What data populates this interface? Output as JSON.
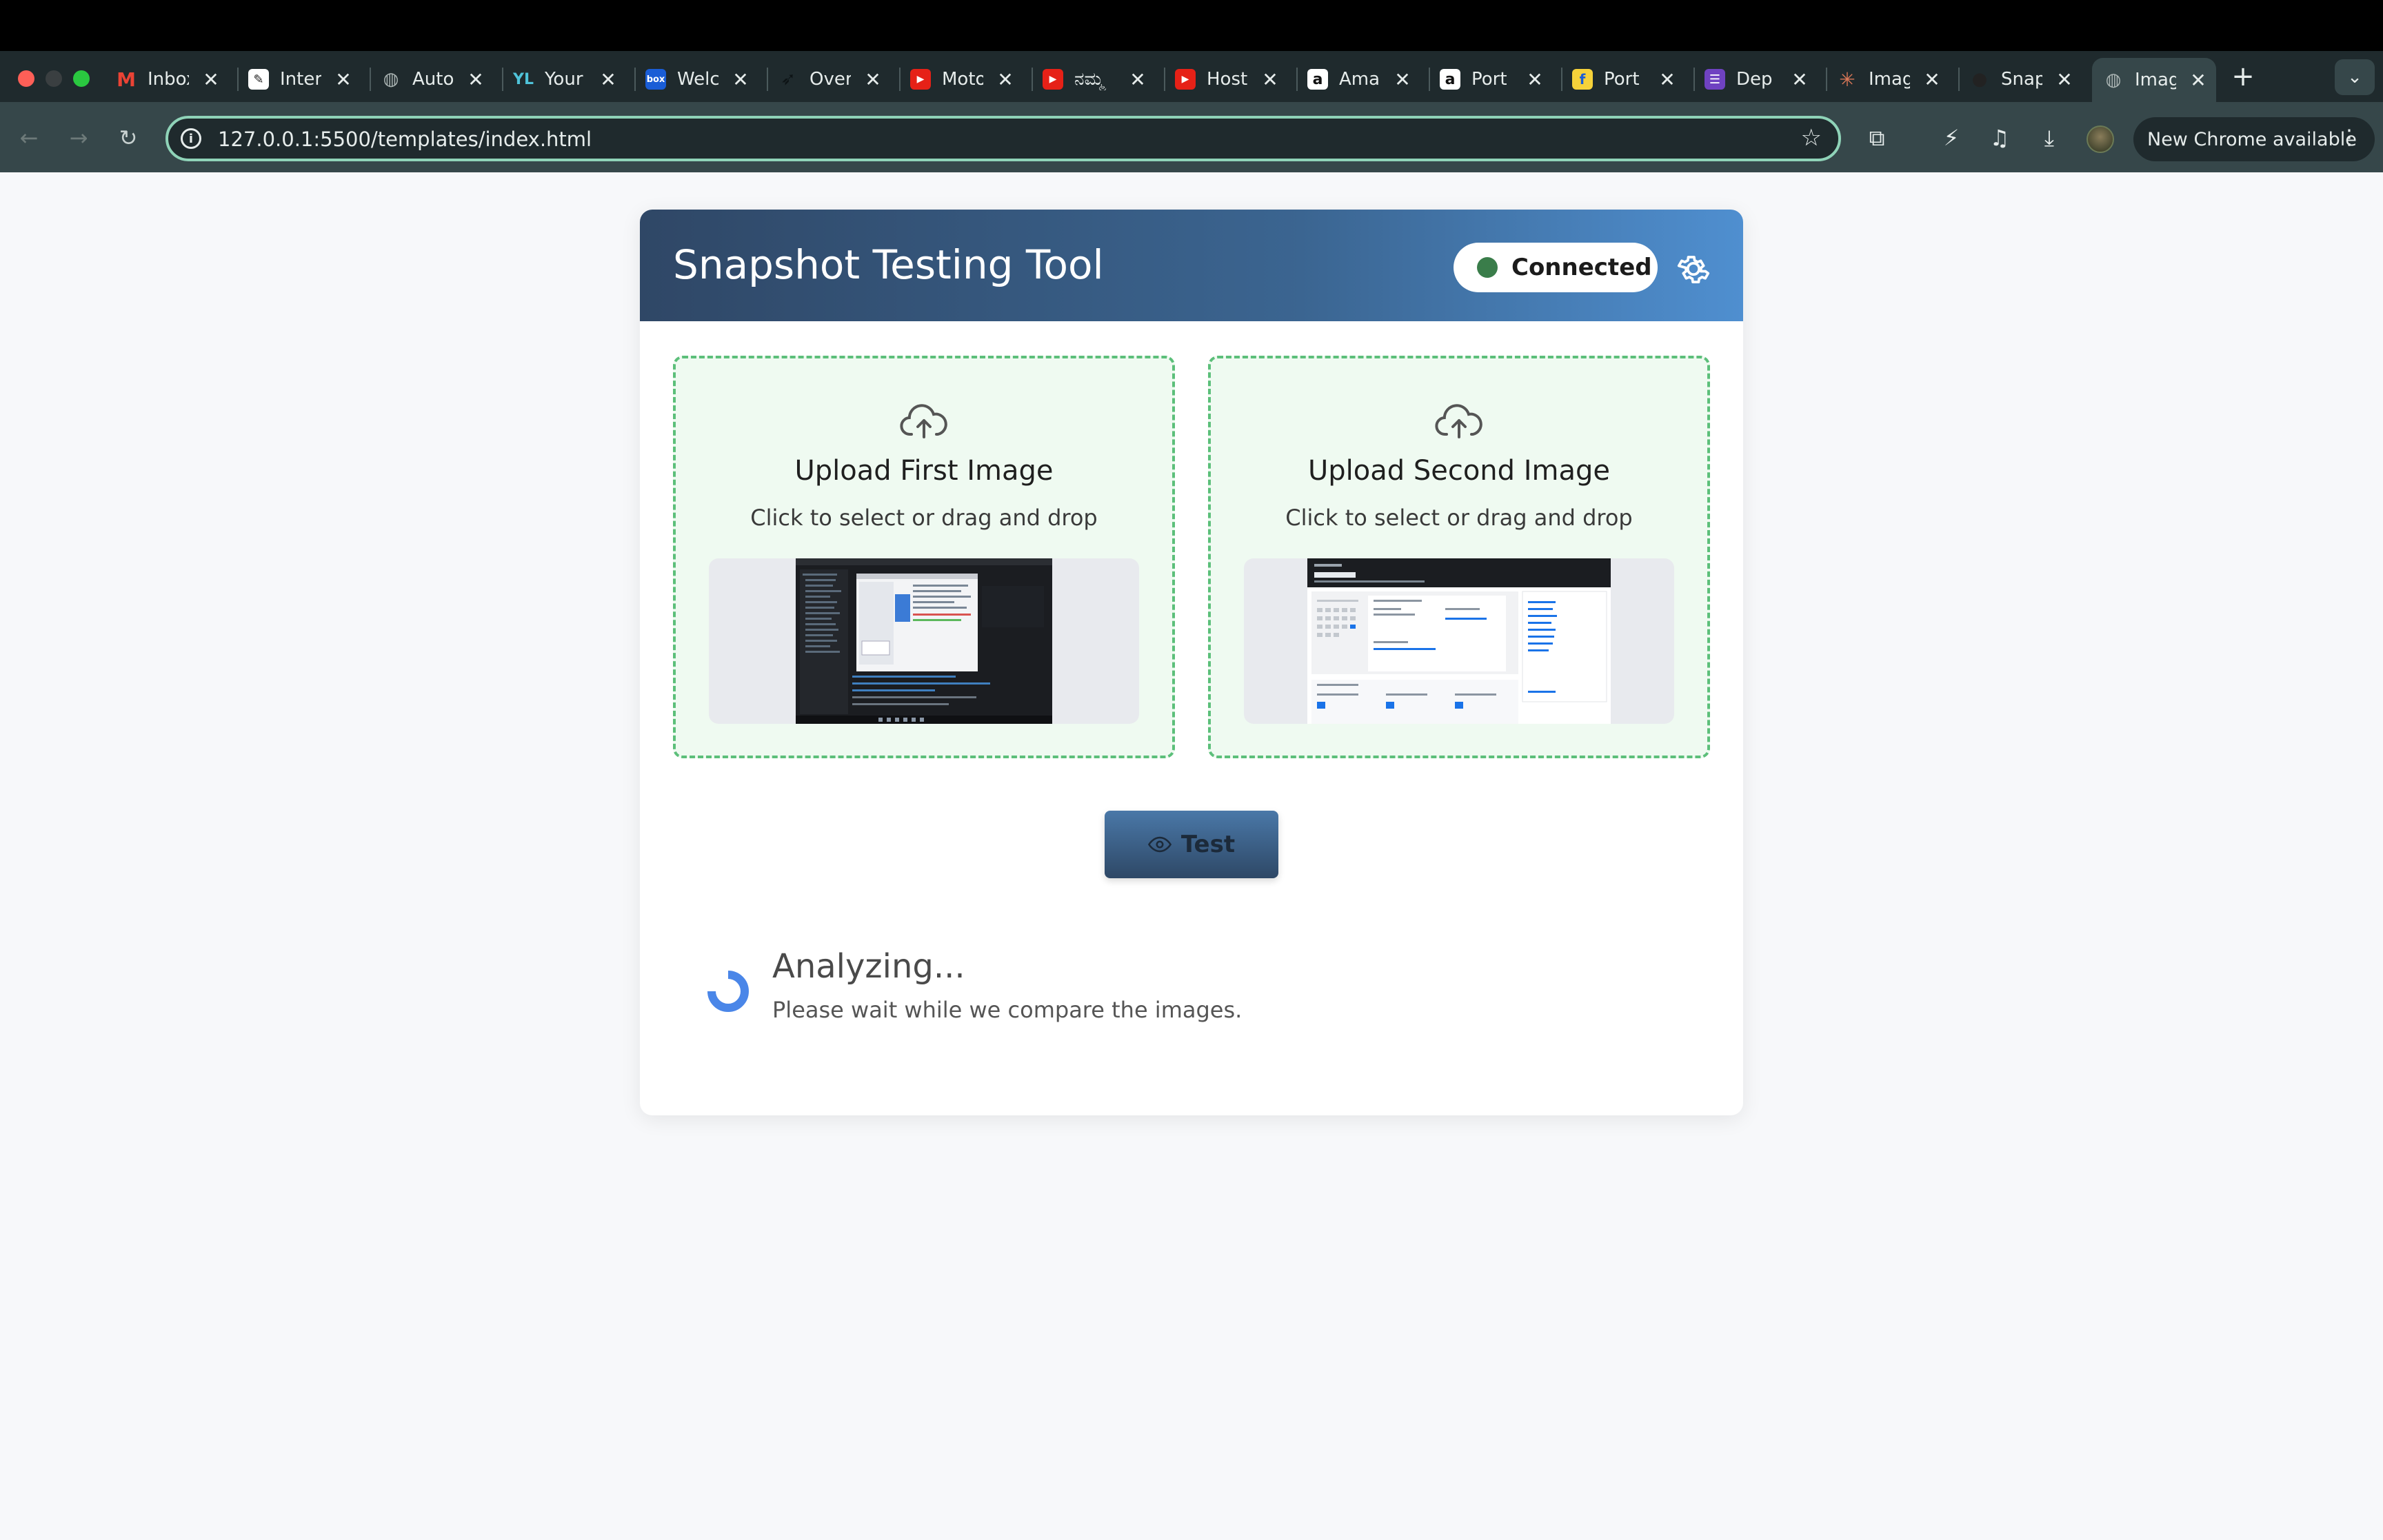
{
  "browser": {
    "tabs": [
      {
        "title": "Inbox",
        "icon": "gmail-icon"
      },
      {
        "title": "Interview",
        "icon": "notes-icon"
      },
      {
        "title": "Auto",
        "icon": "globe-icon"
      },
      {
        "title": "Your",
        "icon": "yl-icon"
      },
      {
        "title": "Welcome",
        "icon": "box-icon"
      },
      {
        "title": "Overview",
        "icon": "bird-icon"
      },
      {
        "title": "Moto",
        "icon": "youtube-icon"
      },
      {
        "title": "ನಮ್ಮ",
        "icon": "youtube-icon"
      },
      {
        "title": "Host",
        "icon": "youtube-icon"
      },
      {
        "title": "Amazon",
        "icon": "amazon-icon"
      },
      {
        "title": "Port",
        "icon": "amazon-icon"
      },
      {
        "title": "Port",
        "icon": "flipkart-icon"
      },
      {
        "title": "Dep",
        "icon": "list-icon"
      },
      {
        "title": "Imag",
        "icon": "claude-icon"
      },
      {
        "title": "Snap",
        "icon": "github-icon"
      },
      {
        "title": "Imag",
        "icon": "globe-icon",
        "active": true
      }
    ],
    "url": "127.0.0.1:5500/templates/index.html",
    "update_label": "New Chrome available"
  },
  "app": {
    "title": "Snapshot Testing Tool",
    "status": "Connected",
    "status_color": "#3a7d4a",
    "upload_first": {
      "title": "Upload First Image",
      "subtitle": "Click to select or drag and drop"
    },
    "upload_second": {
      "title": "Upload Second Image",
      "subtitle": "Click to select or drag and drop"
    },
    "test_button": "Test",
    "analyzing": {
      "title": "Analyzing...",
      "subtitle": "Please wait while we compare the images."
    }
  }
}
